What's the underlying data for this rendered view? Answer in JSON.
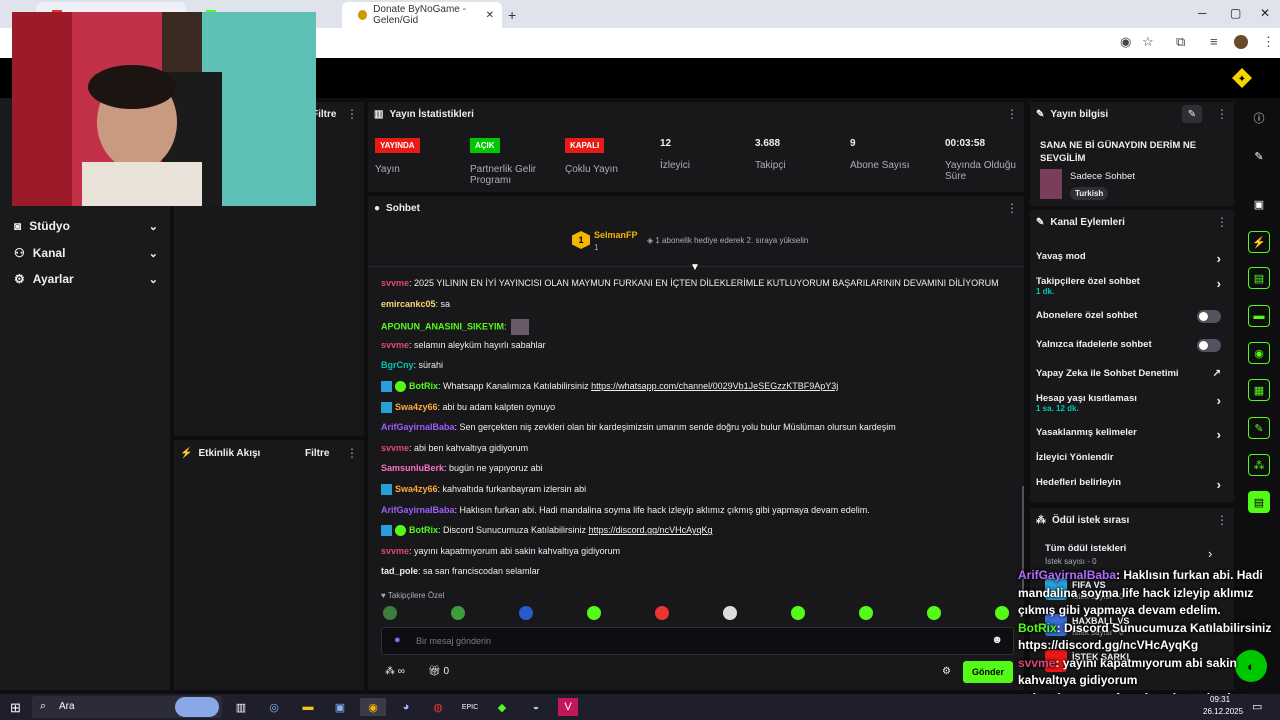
{
  "browser": {
    "tabs": [
      "Donate ByNoGame - Gelen/Gid"
    ],
    "tab_add": "+",
    "window_controls": [
      "─",
      "▢",
      "✕"
    ]
  },
  "nav": {
    "items": [
      {
        "label": "Stüdyo",
        "icon": "studio-icon"
      },
      {
        "label": "Kanal",
        "icon": "channel-icon"
      },
      {
        "label": "Ayarlar",
        "icon": "settings-icon"
      }
    ]
  },
  "left_panels": {
    "top_filter": "Filtre",
    "activity_title": "Etkinlik Akışı",
    "activity_filter": "Filtre"
  },
  "stats": {
    "title": "Yayın İstatistikleri",
    "items": [
      {
        "badge": "YAYINDA",
        "label": "Yayın",
        "color": "#e91916"
      },
      {
        "badge": "AÇIK",
        "label": "Partnerlik Gelir Programı",
        "color": "#00c800"
      },
      {
        "badge": "KAPALI",
        "label": "Çoklu Yayın",
        "color": "#e91916"
      },
      {
        "value": "12",
        "label": "İzleyici"
      },
      {
        "value": "3.688",
        "label": "Takipçi"
      },
      {
        "value": "9",
        "label": "Abone Sayısı"
      },
      {
        "value": "00:03:58",
        "label": "Yayında Olduğu Süre"
      }
    ]
  },
  "chat": {
    "title": "Sohbet",
    "leader": {
      "rank": "1",
      "name": "SelmanFP",
      "count": "1",
      "note": "1 abonelik hediye ederek 2. sıraya yükselin"
    },
    "messages": [
      {
        "user": "svvme",
        "color": "#e0457b",
        "text": ": 2025 YILININ EN İYİ YAYINCISI OLAN MAYMUN FURKANI EN İÇTEN DİLEKLERİMLE KUTLUYORUM BAŞARILARININ DEVAMINI DİLİYORUM"
      },
      {
        "user": "emircankc05",
        "color": "#ffd37a",
        "text": ": sa"
      },
      {
        "user": "APONUN_ANASINI_SIKEYIM",
        "color": "#53fc18",
        "text": ":"
      },
      {
        "user": "svvme",
        "color": "#e0457b",
        "text": ": selamın aleyküm hayırlı sabahlar"
      },
      {
        "user": "BgrCny",
        "color": "#00c8af",
        "text": ": sürahi"
      },
      {
        "user": "BotRix",
        "color": "#53fc18",
        "text": ": Whatsapp Kanalımıza Katılabilirsiniz ",
        "link": "https://whatsapp.com/channel/0029Vb1JeSEGzzKTBF9ApY3j"
      },
      {
        "user": "Swa4zy66",
        "color": "#ffa940",
        "text": ": abi bu adam kalpten oynuyo"
      },
      {
        "user": "ArifGayirnalBaba",
        "color": "#9f5cff",
        "text": ": Sen gerçekten niş zevkleri olan bir kardeşimizsin umarım sende doğru yolu bulur Müslüman olursun kardeşim"
      },
      {
        "user": "svvme",
        "color": "#e0457b",
        "text": ": abi ben kahvaltıya gidiyorum"
      },
      {
        "user": "SamsunluBerk",
        "color": "#ff6ec7",
        "text": ": bugün ne yapıyoruz abi"
      },
      {
        "user": "Swa4zy66",
        "color": "#ffa940",
        "text": ": kahvaltıda furkanbayram izlersin abi"
      },
      {
        "user": "ArifGayirnalBaba",
        "color": "#9f5cff",
        "text": ": Haklısın furkan abi. Hadi mandalina soyma life hack izleyip aklımız çıkmış gibi yapmaya devam edelim."
      },
      {
        "user": "BotRix",
        "color": "#53fc18",
        "text": ": Discord Sunucumuza Katılabilirsiniz ",
        "link": "https://discord.gg/ncVHcAyqKg"
      },
      {
        "user": "svvme",
        "color": "#e0457b",
        "text": ": yayını kapatmıyorum abi sakin kahvaltıya gidiyorum"
      },
      {
        "user": "tad_pole",
        "color": "#efeff1",
        "text": ": sa san franciscodan selamlar"
      }
    ],
    "followers_only": "Takipçilere Özel",
    "input_placeholder": "Bir mesaj gönderin",
    "points": "∞",
    "gift_count": "0",
    "send": "Gönder"
  },
  "stream_info": {
    "title": "Yayın bilgisi",
    "stream_title": "SANA NE Bİ GÜNAYDIN DERİM NE SEVGİLİM",
    "category": "Sadece Sohbet",
    "language": "Turkish"
  },
  "channel_actions": {
    "title": "Kanal Eylemleri",
    "items": [
      {
        "label": "Yavaş mod",
        "control": "arrow"
      },
      {
        "label": "Takipçilere özel sohbet",
        "sub": "1 dk.",
        "control": "arrow"
      },
      {
        "label": "Abonelere özel sohbet",
        "control": "toggle"
      },
      {
        "label": "Yalnızca ifadelerle sohbet",
        "control": "toggle"
      },
      {
        "label": "Yapay Zeka ile Sohbet Denetimi",
        "control": "external"
      },
      {
        "label": "Hesap yaşı kısıtlaması",
        "sub": "1 sa. 12 dk.",
        "control": "arrow"
      },
      {
        "label": "Yasaklanmış kelimeler",
        "control": "arrow"
      },
      {
        "label": "İzleyici Yönlendir",
        "control": "none"
      },
      {
        "label": "Hedefleri belirleyin",
        "control": "arrow"
      }
    ]
  },
  "rewards": {
    "title": "Ödül istek sırası",
    "all": "Tüm ödül istekleri",
    "all_sub": "İstek sayısı - 0",
    "items": [
      {
        "label": "FIFA VS",
        "sub": "İstek sayısı - 0"
      },
      {
        "label": "HAXBALL VS",
        "sub": "İstek sayısı - 0"
      },
      {
        "label": "İSTEK ŞARKI",
        "sub": ""
      }
    ]
  },
  "overlay": [
    {
      "user": "ArifGayirnalBaba",
      "color": "#b36bff",
      "text": ": Haklısın furkan abi. Hadi mandalina soyma life hack izleyip aklımız çıkmış gibi yapmaya devam edelim."
    },
    {
      "user": "BotRix",
      "color": "#53fc18",
      "text": ": Discord Sunucumuza Katılabilirsiniz https://discord.gg/ncVHcAyqKg"
    },
    {
      "user": "svvme",
      "color": "#e0457b",
      "text": ": yayını kapatmıyorum abi sakin kahvaltıya gidiyorum"
    },
    {
      "user": "tad_pole",
      "color": "#efeff1",
      "text": ": sa san franciscodan selamlar"
    }
  ],
  "taskbar": {
    "search": "Ara",
    "time": "09:31",
    "date": "26.12.2025"
  },
  "colors": {
    "accent": "#53fc18",
    "live": "#e91916",
    "bg": "#0e0e10",
    "panel": "#18181b"
  }
}
